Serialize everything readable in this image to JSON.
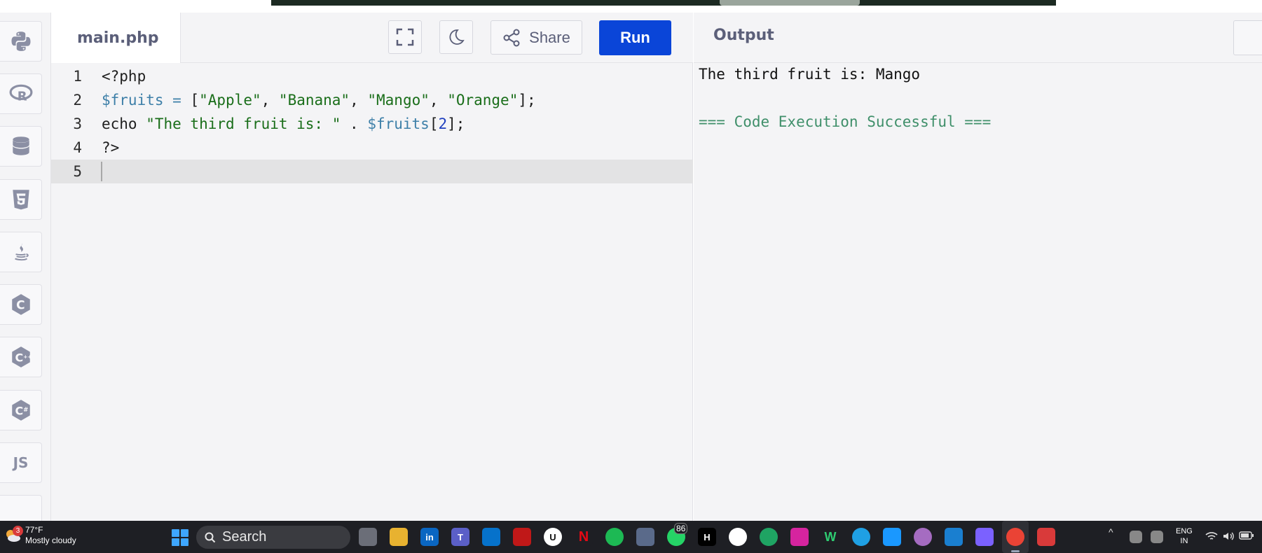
{
  "editor": {
    "file_name": "main.php",
    "share_label": "Share",
    "run_label": "Run",
    "lines": [
      {
        "num": "1",
        "tokens": [
          {
            "t": "kw",
            "v": "<?php"
          }
        ]
      },
      {
        "num": "2",
        "tokens": [
          {
            "t": "var",
            "v": "$fruits"
          },
          {
            "t": "op",
            "v": " = "
          },
          {
            "t": "kw",
            "v": "["
          },
          {
            "t": "str",
            "v": "\"Apple\""
          },
          {
            "t": "kw",
            "v": ", "
          },
          {
            "t": "str",
            "v": "\"Banana\""
          },
          {
            "t": "kw",
            "v": ", "
          },
          {
            "t": "str",
            "v": "\"Mango\""
          },
          {
            "t": "kw",
            "v": ", "
          },
          {
            "t": "str",
            "v": "\"Orange\""
          },
          {
            "t": "kw",
            "v": "];"
          }
        ]
      },
      {
        "num": "3",
        "tokens": [
          {
            "t": "kw",
            "v": "echo "
          },
          {
            "t": "str",
            "v": "\"The third fruit is: \""
          },
          {
            "t": "kw",
            "v": " . "
          },
          {
            "t": "var",
            "v": "$fruits"
          },
          {
            "t": "kw",
            "v": "["
          },
          {
            "t": "num",
            "v": "2"
          },
          {
            "t": "kw",
            "v": "];"
          }
        ]
      },
      {
        "num": "4",
        "tokens": [
          {
            "t": "kw",
            "v": "?>"
          }
        ]
      },
      {
        "num": "5",
        "tokens": []
      }
    ],
    "active_line": 5
  },
  "output": {
    "title": "Output",
    "result_text": "The third fruit is: Mango",
    "success_text": "=== Code Execution Successful ==="
  },
  "sidebar": {
    "languages": [
      "python-icon",
      "r-icon",
      "sql-icon",
      "html5-icon",
      "java-icon",
      "c-icon",
      "cpp-icon",
      "csharp-icon",
      "javascript-icon"
    ],
    "js_label": "JS"
  },
  "taskbar": {
    "temperature": "77°F",
    "weather": "Mostly cloudy",
    "weather_badge": "3",
    "search_label": "Search",
    "whatsapp_badge": "86",
    "lang_line1": "ENG",
    "lang_line2": "IN"
  },
  "colors": {
    "run_button": "#0a45d8",
    "success": "#3f8f6a",
    "string": "#1a6e1a",
    "variable": "#3d7fa8"
  }
}
